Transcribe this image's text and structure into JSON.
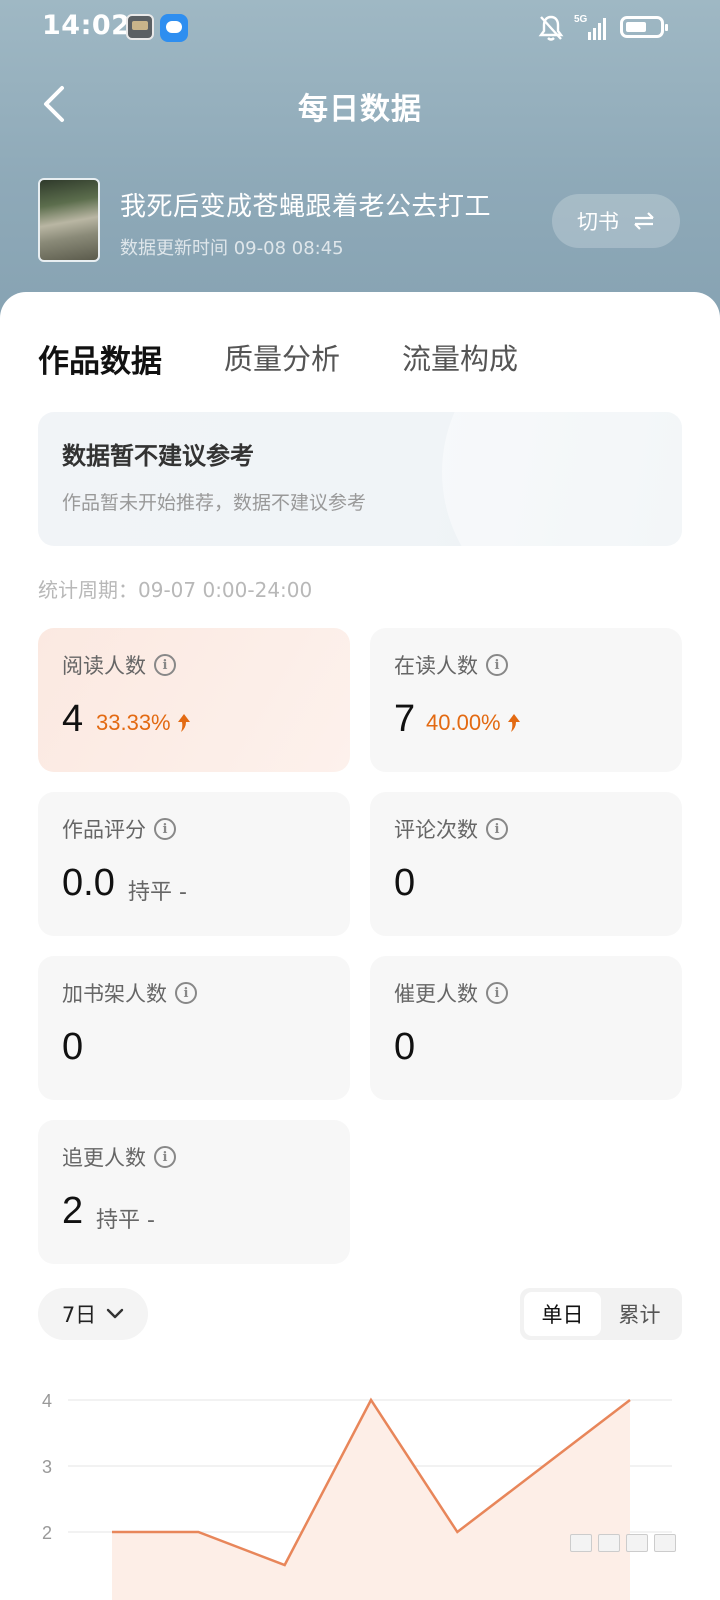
{
  "status_bar": {
    "time": "14:02",
    "network": "5G"
  },
  "header": {
    "title": "每日数据",
    "book_title": "我死后变成苍蝇跟着老公去打工",
    "update_time": "数据更新时间 09-08 08:45",
    "switch_label": "切书"
  },
  "tabs": [
    {
      "label": "作品数据",
      "active": true
    },
    {
      "label": "质量分析",
      "active": false
    },
    {
      "label": "流量构成",
      "active": false
    }
  ],
  "notice": {
    "title": "数据暂不建议参考",
    "description": "作品暂未开始推荐，数据不建议参考"
  },
  "period": "统计周期：09-07 0:00-24:00",
  "metrics": [
    {
      "label": "阅读人数",
      "value": "4",
      "change": "33.33%",
      "trend": "up"
    },
    {
      "label": "在读人数",
      "value": "7",
      "change": "40.00%",
      "trend": "up"
    },
    {
      "label": "作品评分",
      "value": "0.0",
      "flat": "持平 -"
    },
    {
      "label": "评论次数",
      "value": "0"
    },
    {
      "label": "加书架人数",
      "value": "0"
    },
    {
      "label": "催更人数",
      "value": "0"
    },
    {
      "label": "追更人数",
      "value": "2",
      "flat": "持平 -"
    }
  ],
  "controls": {
    "range_label": "7日",
    "segment": [
      "单日",
      "累计"
    ]
  },
  "chart_data": {
    "type": "area",
    "x": [
      1,
      2,
      3,
      4,
      5,
      6,
      7
    ],
    "series": [
      {
        "values": [
          2,
          2,
          1.5,
          4,
          2,
          3,
          4
        ]
      }
    ],
    "yticks": [
      "2",
      "3",
      "4"
    ],
    "ylim": [
      1.5,
      4.2
    ],
    "line_color": "#e8865a",
    "fill_color": "#fdeee7"
  },
  "colors": {
    "accent_orange": "#e36a12",
    "header_blue": "#8ea9b8"
  }
}
